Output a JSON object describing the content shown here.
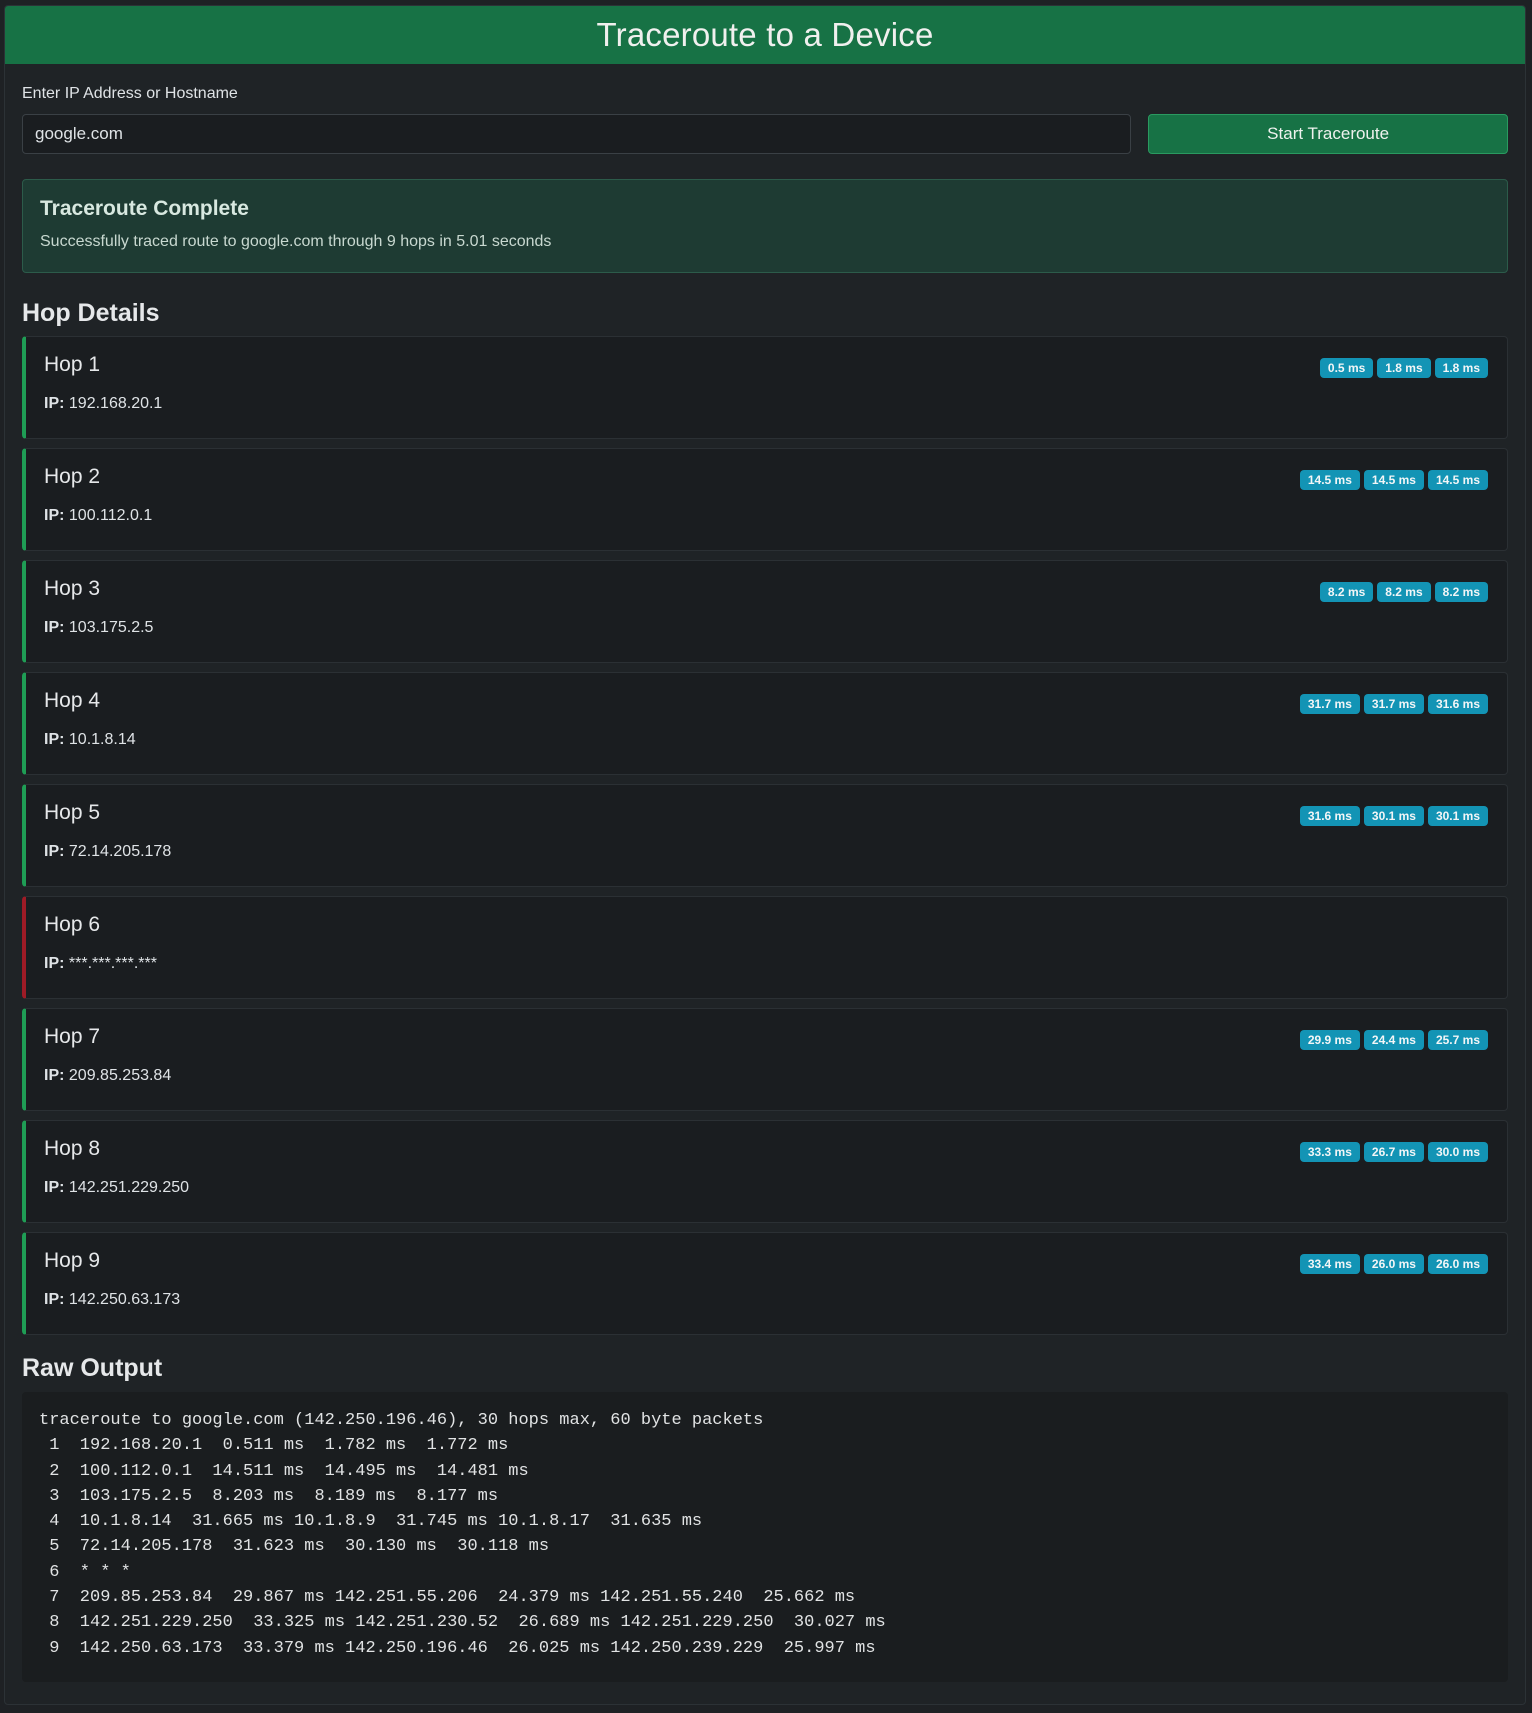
{
  "header": {
    "title": "Traceroute to a Device"
  },
  "form": {
    "label": "Enter IP Address or Hostname",
    "value": "google.com",
    "button_label": "Start Traceroute"
  },
  "status": {
    "title": "Traceroute Complete",
    "message": "Successfully traced route to google.com through 9 hops in 5.01 seconds"
  },
  "hops_section": {
    "title": "Hop Details",
    "ip_label": "IP:"
  },
  "hops": [
    {
      "name": "Hop 1",
      "ip": "192.168.20.1",
      "ok": true,
      "times": [
        "0.5 ms",
        "1.8 ms",
        "1.8 ms"
      ]
    },
    {
      "name": "Hop 2",
      "ip": "100.112.0.1",
      "ok": true,
      "times": [
        "14.5 ms",
        "14.5 ms",
        "14.5 ms"
      ]
    },
    {
      "name": "Hop 3",
      "ip": "103.175.2.5",
      "ok": true,
      "times": [
        "8.2 ms",
        "8.2 ms",
        "8.2 ms"
      ]
    },
    {
      "name": "Hop 4",
      "ip": "10.1.8.14",
      "ok": true,
      "times": [
        "31.7 ms",
        "31.7 ms",
        "31.6 ms"
      ]
    },
    {
      "name": "Hop 5",
      "ip": "72.14.205.178",
      "ok": true,
      "times": [
        "31.6 ms",
        "30.1 ms",
        "30.1 ms"
      ]
    },
    {
      "name": "Hop 6",
      "ip": "***.***.***.***",
      "ok": false,
      "times": []
    },
    {
      "name": "Hop 7",
      "ip": "209.85.253.84",
      "ok": true,
      "times": [
        "29.9 ms",
        "24.4 ms",
        "25.7 ms"
      ]
    },
    {
      "name": "Hop 8",
      "ip": "142.251.229.250",
      "ok": true,
      "times": [
        "33.3 ms",
        "26.7 ms",
        "30.0 ms"
      ]
    },
    {
      "name": "Hop 9",
      "ip": "142.250.63.173",
      "ok": true,
      "times": [
        "33.4 ms",
        "26.0 ms",
        "26.0 ms"
      ]
    }
  ],
  "raw_section": {
    "title": "Raw Output"
  },
  "raw_output": [
    "traceroute to google.com (142.250.196.46), 30 hops max, 60 byte packets",
    " 1  192.168.20.1  0.511 ms  1.782 ms  1.772 ms",
    " 2  100.112.0.1  14.511 ms  14.495 ms  14.481 ms",
    " 3  103.175.2.5  8.203 ms  8.189 ms  8.177 ms",
    " 4  10.1.8.14  31.665 ms 10.1.8.9  31.745 ms 10.1.8.17  31.635 ms",
    " 5  72.14.205.178  31.623 ms  30.130 ms  30.118 ms",
    " 6  * * *",
    " 7  209.85.253.84  29.867 ms 142.251.55.206  24.379 ms 142.251.55.240  25.662 ms",
    " 8  142.251.229.250  33.325 ms 142.251.230.52  26.689 ms 142.251.229.250  30.027 ms",
    " 9  142.250.63.173  33.379 ms 142.250.196.46  26.025 ms 142.250.239.229  25.997 ms"
  ],
  "colors": {
    "accent": "#177245",
    "success_border": "#1f9d55",
    "failure_border": "#9e1b26",
    "badge": "#1394b5"
  }
}
